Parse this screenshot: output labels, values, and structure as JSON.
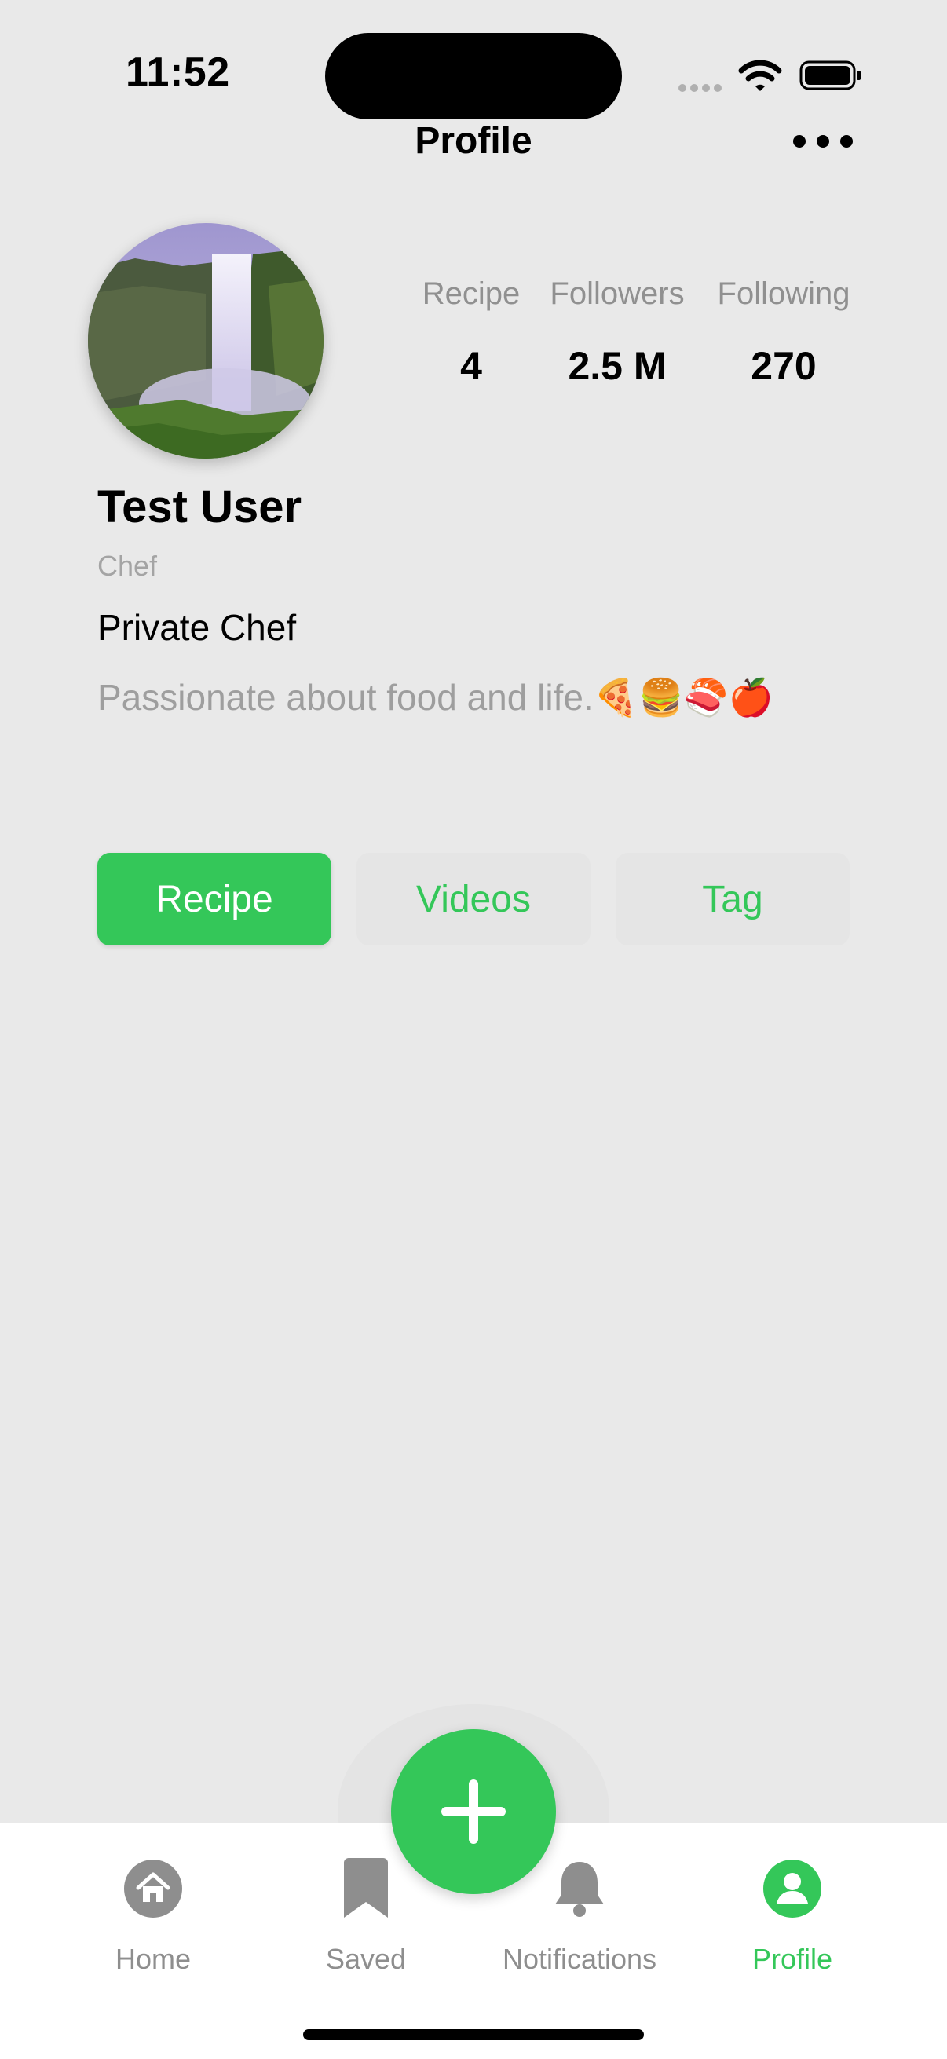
{
  "status_bar": {
    "time": "11:52"
  },
  "header": {
    "title": "Profile",
    "more_icon": "more-horizontal-icon"
  },
  "profile": {
    "name": "Test User",
    "role": "Chef",
    "title": "Private Chef",
    "bio": "Passionate about food and life.🍕🍔🍣🍎"
  },
  "stats": [
    {
      "label": "Recipe",
      "value": "4"
    },
    {
      "label": "Followers",
      "value": "2.5 M"
    },
    {
      "label": "Following",
      "value": "270"
    }
  ],
  "tabs": [
    {
      "label": "Recipe",
      "active": true
    },
    {
      "label": "Videos",
      "active": false
    },
    {
      "label": "Tag",
      "active": false
    }
  ],
  "bottom_nav": [
    {
      "label": "Home",
      "icon": "home-icon",
      "active": false
    },
    {
      "label": "Saved",
      "icon": "bookmark-icon",
      "active": false
    },
    {
      "label": "Notifications",
      "icon": "bell-icon",
      "active": false
    },
    {
      "label": "Profile",
      "icon": "person-icon",
      "active": true
    }
  ],
  "fab_icon": "plus-icon",
  "colors": {
    "accent": "#34c759",
    "background": "#e9e9e9",
    "muted": "#8e8e8e"
  }
}
